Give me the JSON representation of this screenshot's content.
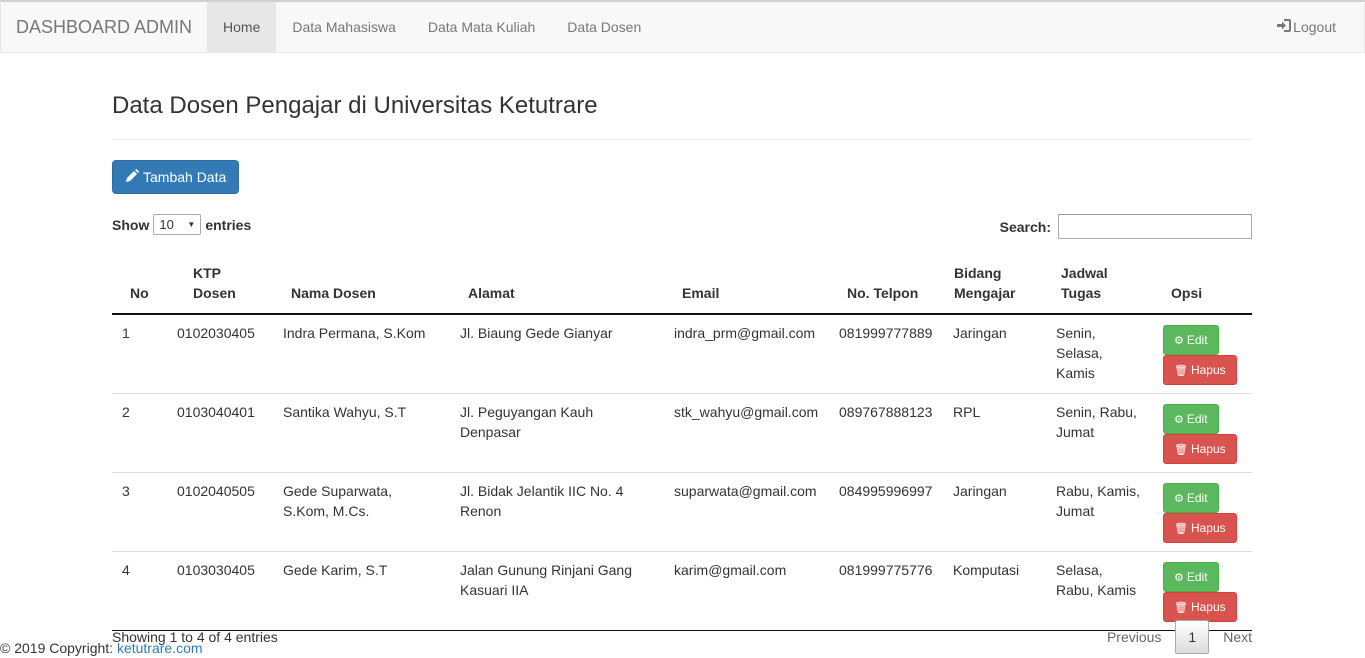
{
  "navbar": {
    "brand": "DASHBOARD ADMIN",
    "items": [
      {
        "label": "Home",
        "active": true
      },
      {
        "label": "Data Mahasiswa",
        "active": false
      },
      {
        "label": "Data Mata Kuliah",
        "active": false
      },
      {
        "label": "Data Dosen",
        "active": false
      }
    ],
    "logout_label": "Logout",
    "logout_icon": "log-in-icon"
  },
  "page": {
    "title": "Data Dosen Pengajar di Universitas Ketutrare",
    "add_button": {
      "label": "Tambah Data",
      "icon": "pencil-icon"
    }
  },
  "table_controls": {
    "show_label": "Show",
    "entries_label": "entries",
    "page_length": "10",
    "search_label": "Search:",
    "search_value": ""
  },
  "table": {
    "headers": [
      {
        "line1": "",
        "line2": "No"
      },
      {
        "line1": "KTP",
        "line2": "Dosen"
      },
      {
        "line1": "",
        "line2": "Nama Dosen"
      },
      {
        "line1": "",
        "line2": "Alamat"
      },
      {
        "line1": "",
        "line2": "Email"
      },
      {
        "line1": "",
        "line2": "No. Telpon"
      },
      {
        "line1": "Bidang",
        "line2": "Mengajar"
      },
      {
        "line1": "Jadwal",
        "line2": "Tugas"
      },
      {
        "line1": "",
        "line2": "Opsi"
      }
    ],
    "rows": [
      {
        "no": "1",
        "ktp": "0102030405",
        "nama": "Indra Permana, S.Kom",
        "alamat": "Jl. Biaung Gede Gianyar",
        "email": "indra_prm@gmail.com",
        "telpon": "081999777889",
        "bidang": "Jaringan",
        "jadwal": "Senin, Selasa, Kamis"
      },
      {
        "no": "2",
        "ktp": "0103040401",
        "nama": "Santika Wahyu, S.T",
        "alamat": "Jl. Peguyangan Kauh Denpasar",
        "email": "stk_wahyu@gmail.com",
        "telpon": "089767888123",
        "bidang": "RPL",
        "jadwal": "Senin, Rabu, Jumat"
      },
      {
        "no": "3",
        "ktp": "0102040505",
        "nama": "Gede Suparwata, S.Kom, M.Cs.",
        "alamat": "Jl. Bidak Jelantik IIC No. 4 Renon",
        "email": "suparwata@gmail.com",
        "telpon": "084995996997",
        "bidang": "Jaringan",
        "jadwal": "Rabu, Kamis, Jumat"
      },
      {
        "no": "4",
        "ktp": "0103030405",
        "nama": "Gede Karim, S.T",
        "alamat": "Jalan Gunung Rinjani Gang Kasuari IIA",
        "email": "karim@gmail.com",
        "telpon": "081999775776",
        "bidang": "Komputasi",
        "jadwal": "Selasa, Rabu, Kamis"
      }
    ],
    "edit_label": "Edit",
    "delete_label": "Hapus"
  },
  "pagination": {
    "info": "Showing 1 to 4 of 4 entries",
    "previous": "Previous",
    "current_page": "1",
    "next": "Next"
  },
  "footer": {
    "copyright": "© 2019 Copyright: ",
    "link": "ketutrare.com"
  },
  "colors": {
    "primary": "#337ab7",
    "success": "#5cb85c",
    "danger": "#d9534f"
  }
}
